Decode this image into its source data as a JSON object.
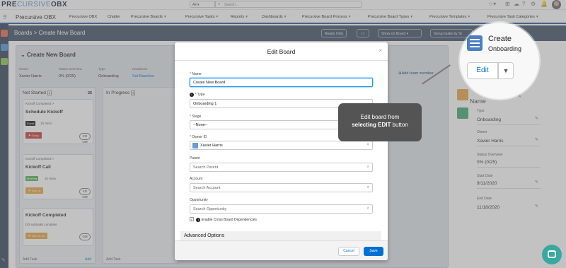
{
  "topbar": {
    "logo_left": "PRE",
    "logo_mid": "CURSIVE",
    "logo_right": "OBX",
    "search_scope": "All",
    "search_placeholder": "Search..."
  },
  "nav": {
    "app_name": "Precursive OBX",
    "items": [
      "Precursive OBX",
      "Chatter",
      "Precursive Boards",
      "Precursive Tasks",
      "Reports",
      "Dashboards",
      "Precursive Board Process",
      "Precursive Board Types",
      "Precursive Templates",
      "Precursive Task Categories"
    ]
  },
  "toolbar": {
    "breadcrumb": "Boards > Create New Board",
    "ready_only": "Ready Only",
    "show_on_board": "Show on Board",
    "group_tasks": "Group tasks by St"
  },
  "board": {
    "title": "Create New Board",
    "meta": [
      {
        "label": "Owner",
        "value": "Xavier Harris"
      },
      {
        "label": "Status Overview",
        "value": "0% (0/25)"
      },
      {
        "label": "Type",
        "value": "Onboarding"
      },
      {
        "label": "Readiness",
        "value": "Set Baseline"
      }
    ],
    "add_team_member": "Add team member",
    "columns": [
      {
        "name": "Not Started",
        "count": "25"
      },
      {
        "name": "In Progress",
        "count": ""
      }
    ],
    "cards": [
      {
        "parent": "Kickoff Completed >",
        "title": "Schedule Kickoff",
        "status": "Event",
        "duration": "1h 0min",
        "date": "Today",
        "owner": "XO OM"
      },
      {
        "parent": "Kickoff Completed >",
        "title": "Kickoff Call",
        "status": "Meeting",
        "duration": "1h 0min",
        "date": "Sep 18",
        "owner": "XO OM"
      },
      {
        "parent": "",
        "title": "Kickoff Completed",
        "status": "0/3 subtasks complete",
        "duration": "",
        "date": "Sep 18-30",
        "owner": "OM"
      }
    ],
    "add_task": "Add Task",
    "add": "Add"
  },
  "modal": {
    "title": "Edit Board",
    "fields": [
      {
        "label": "Name",
        "required": true,
        "value": "Create New Board",
        "placeholder": ""
      },
      {
        "label": "Type",
        "required": true,
        "value": "Onboarding 1",
        "placeholder": ""
      },
      {
        "label": "Stage",
        "required": true,
        "value": "--None--",
        "placeholder": ""
      },
      {
        "label": "Owner ID",
        "required": true,
        "value": "Xavier Harris",
        "placeholder": ""
      },
      {
        "label": "Parent",
        "required": false,
        "value": "",
        "placeholder": "Search Parent"
      },
      {
        "label": "Account",
        "required": false,
        "value": "",
        "placeholder": "Search Account"
      },
      {
        "label": "Opportunity",
        "required": false,
        "value": "",
        "placeholder": "Search Opportunity"
      }
    ],
    "checkbox_label": "Enable Cross Board Dependencies",
    "advanced": "Advanced Options",
    "cancel": "Cancel",
    "save": "Save"
  },
  "tooltip": {
    "line1": "Edit board from",
    "line2_bold": "selecting EDIT",
    "line2_rest": " button"
  },
  "magnifier": {
    "title": "Create",
    "subtitle": "Onboarding",
    "edit": "Edit"
  },
  "right_panel": {
    "name_label": "Name",
    "fields": [
      {
        "label": "Type",
        "value": "Onboarding"
      },
      {
        "label": "Owner",
        "value": "Xavier Harris"
      },
      {
        "label": "Status Overview",
        "value": "0% (0/25)"
      },
      {
        "label": "Start Date",
        "value": "9/11/2020"
      },
      {
        "label": "End Date",
        "value": "11/18/2020"
      }
    ]
  },
  "colors": {
    "nav_accent": "#1b5297",
    "toolbar_bg": "#3a4a62",
    "save_blue": "#0070d2",
    "tooltip_bg": "#545454",
    "chat_teal": "#39a8a0"
  }
}
